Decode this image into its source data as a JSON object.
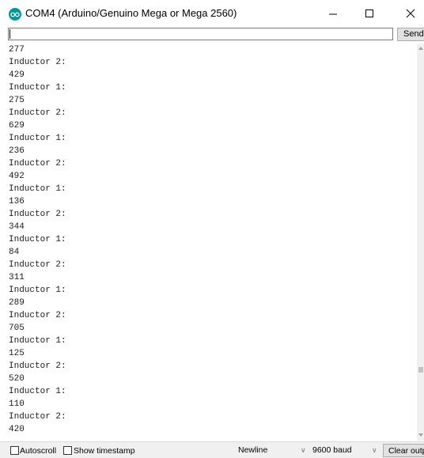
{
  "window": {
    "title": "COM4 (Arduino/Genuino Mega or Mega 2560)",
    "icon": "arduino-icon"
  },
  "input": {
    "value": "",
    "send_label": "Send"
  },
  "output": {
    "lines": [
      "277",
      "Inductor 2:",
      "429",
      "Inductor 1:",
      "275",
      "Inductor 2:",
      "629",
      "Inductor 1:",
      "236",
      "Inductor 2:",
      "492",
      "Inductor 1:",
      "136",
      "Inductor 2:",
      "344",
      "Inductor 1:",
      "84",
      "Inductor 2:",
      "311",
      "Inductor 1:",
      "289",
      "Inductor 2:",
      "705",
      "Inductor 1:",
      "125",
      "Inductor 2:",
      "520",
      "Inductor 1:",
      "110",
      "Inductor 2:",
      "420"
    ]
  },
  "footer": {
    "autoscroll_label": "Autoscroll",
    "autoscroll_checked": false,
    "timestamp_label": "Show timestamp",
    "timestamp_checked": false,
    "line_ending": "Newline",
    "baud_rate": "9600 baud",
    "clear_label": "Clear output"
  },
  "colors": {
    "accent": "#00979c"
  }
}
